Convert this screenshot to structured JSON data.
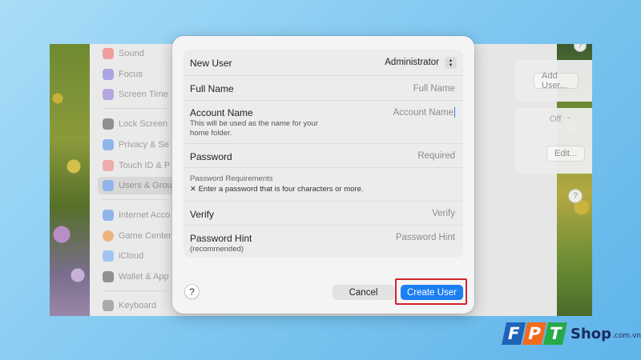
{
  "background_sidebar": {
    "items": [
      {
        "label": "Sound",
        "color": "#f29a9a"
      },
      {
        "label": "Focus",
        "color": "#a9a2e6"
      },
      {
        "label": "Screen Time",
        "color": "#b3a4e0"
      },
      {
        "label": "Lock Screen",
        "color": "#8d8d8d"
      },
      {
        "label": "Privacy & Se",
        "color": "#8eb4ec"
      },
      {
        "label": "Touch ID & P",
        "color": "#f0a9a9"
      },
      {
        "label": "Users & Grou",
        "color": "#8eb4ec"
      },
      {
        "label": "Internet Acco",
        "color": "#8eb4ec"
      },
      {
        "label": "Game Center",
        "color": "#f0b37a"
      },
      {
        "label": "iCloud",
        "color": "#9cc4f0"
      },
      {
        "label": "Wallet & App",
        "color": "#8d8d8d"
      },
      {
        "label": "Keyboard",
        "color": "#a8a8a8"
      }
    ]
  },
  "background_panel": {
    "add_user_label": "Add User...",
    "off_label": "Off",
    "edit_label": "Edit...",
    "help_label": "?",
    "info_label": "?"
  },
  "dialog": {
    "new_user": {
      "label": "New User",
      "value": "Administrator"
    },
    "full_name": {
      "label": "Full Name",
      "placeholder": "Full Name"
    },
    "account_name": {
      "label": "Account Name",
      "placeholder": "Account Name",
      "sub": "This will be used as the name for your home folder."
    },
    "password": {
      "label": "Password",
      "placeholder": "Required"
    },
    "password_requirements": {
      "title": "Password Requirements",
      "rule": "✕ Enter a password that is four characters or more."
    },
    "verify": {
      "label": "Verify",
      "placeholder": "Verify"
    },
    "password_hint": {
      "label": "Password Hint",
      "sub": "(recommended)",
      "placeholder": "Password Hint"
    },
    "help_label": "?",
    "cancel_label": "Cancel",
    "create_label": "Create User",
    "accent_color": "#1c7ef3",
    "highlight_color": "#d4242b"
  },
  "logo": {
    "letters": [
      "F",
      "P",
      "T"
    ],
    "shop": "Shop",
    "domain": ".com.vn"
  }
}
